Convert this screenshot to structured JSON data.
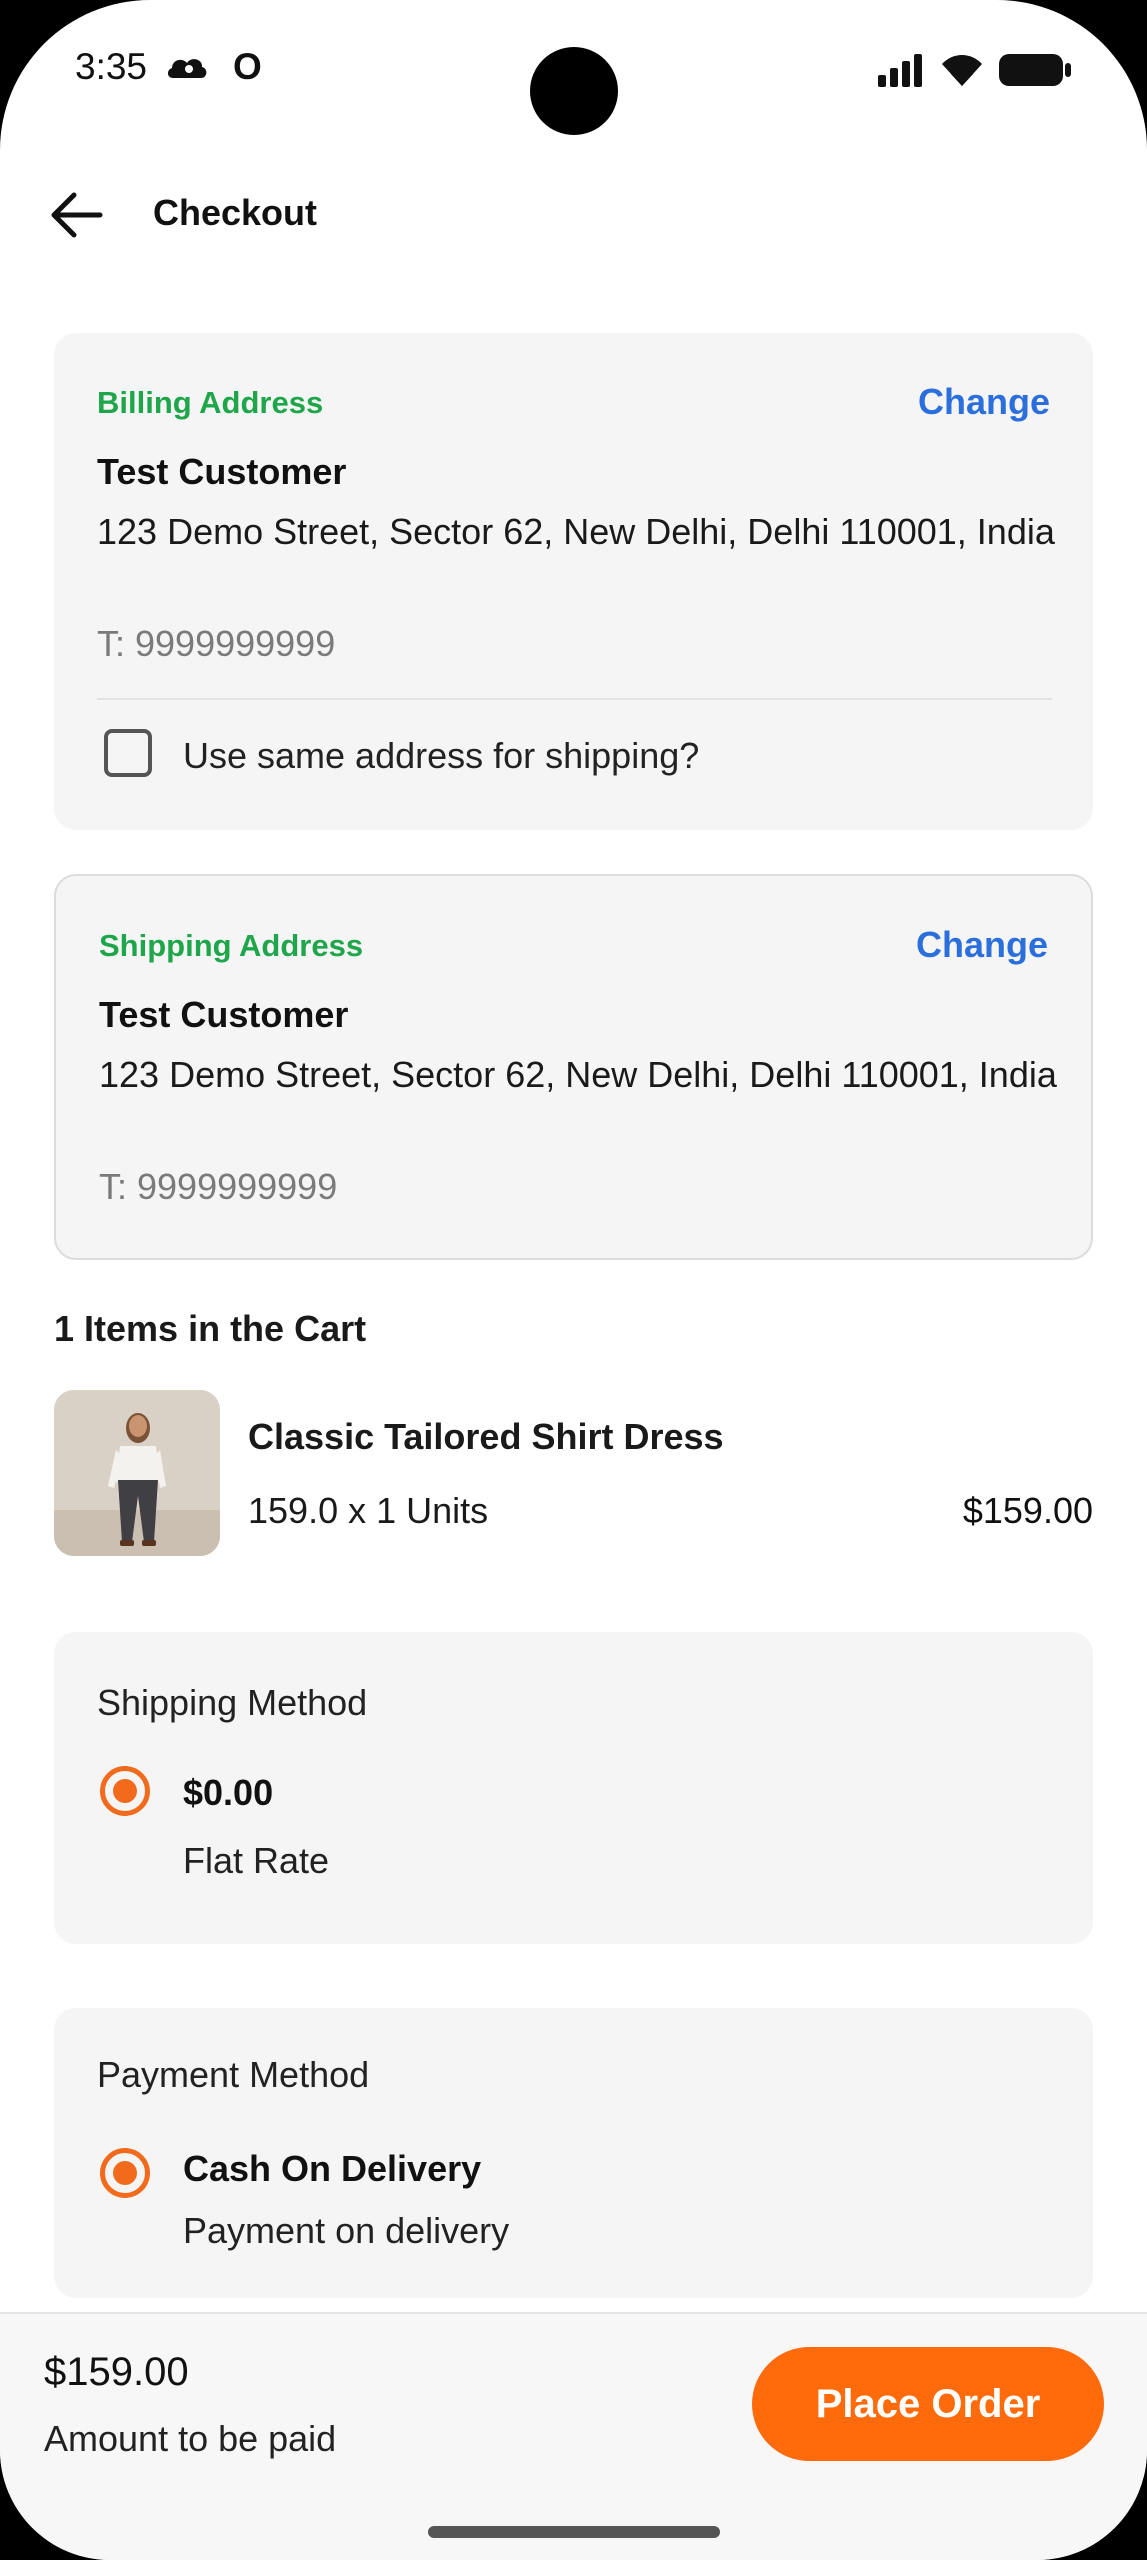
{
  "status_bar": {
    "time": "3:35",
    "extra_icon_text": "O",
    "icons": [
      "cloud-icon",
      "signal-icon",
      "wifi-icon",
      "battery-icon"
    ]
  },
  "header": {
    "title": "Checkout",
    "back_icon": "arrow-left-icon"
  },
  "billing": {
    "label": "Billing Address",
    "change_label": "Change",
    "name": "Test Customer",
    "address": "123 Demo Street, Sector 62, New Delhi, Delhi 110001, India",
    "phone": "T: 9999999999",
    "same_address_label": "Use same address for shipping?",
    "same_address_checked": false
  },
  "shipping": {
    "label": "Shipping Address",
    "change_label": "Change",
    "name": "Test Customer",
    "address": "123 Demo Street, Sector 62, New Delhi, Delhi 110001, India",
    "phone": "T: 9999999999"
  },
  "cart": {
    "heading": "1 Items in the Cart",
    "items": [
      {
        "name": "Classic Tailored Shirt Dress",
        "qty_text": "159.0 x 1 Units",
        "price": "$159.00"
      }
    ]
  },
  "shipping_method": {
    "title": "Shipping Method",
    "options": [
      {
        "price": "$0.00",
        "name": "Flat Rate",
        "selected": true
      }
    ]
  },
  "payment_method": {
    "title": "Payment Method",
    "options": [
      {
        "name": "Cash On Delivery",
        "description": "Payment on delivery",
        "selected": true
      }
    ]
  },
  "footer": {
    "total": "$159.00",
    "total_label": "Amount to be paid",
    "place_order_label": "Place Order"
  },
  "colors": {
    "accent": "#ff6a0a",
    "radio": "#f26b1d",
    "label_green": "#1fa64a",
    "link_blue": "#2a6fdb",
    "card_bg": "#f5f5f5"
  }
}
